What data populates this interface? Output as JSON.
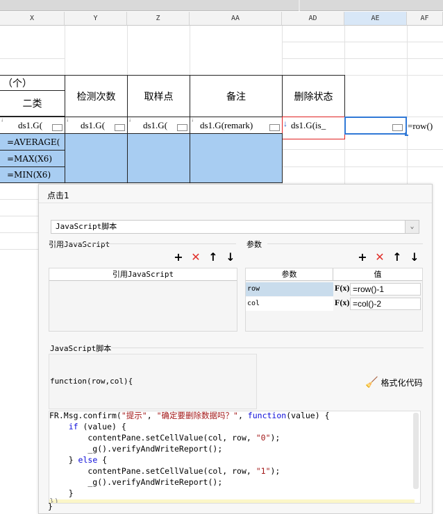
{
  "columns": [
    {
      "id": "x",
      "label": "X"
    },
    {
      "id": "y",
      "label": "Y"
    },
    {
      "id": "z",
      "label": "Z"
    },
    {
      "id": "aa",
      "label": "AA"
    },
    {
      "id": "ad",
      "label": "AD"
    },
    {
      "id": "ae",
      "label": "AE",
      "selected": true
    },
    {
      "id": "af",
      "label": "AF"
    }
  ],
  "grid": {
    "unit_label": "（个）",
    "category_label": "二类",
    "headers": {
      "inspect_count": "检测次数",
      "sample_point": "取样点",
      "remark": "备注",
      "delete_status": "删除状态"
    },
    "ds_cells": {
      "x": "ds1.G(",
      "y": "ds1.G(",
      "z": "ds1.G(",
      "aa": "ds1.G(remark)",
      "ad": "ds1.G(is_",
      "af": "=row()"
    },
    "formulas": {
      "avg": "=AVERAGE(",
      "max": "=MAX(X6)",
      "min": "=MIN(X6)"
    }
  },
  "dialog": {
    "title": "点击1",
    "script_type": "JavaScript脚本",
    "ref_js_label": "引用JavaScript",
    "ref_js_header": "引用JavaScript",
    "params_label": "参数",
    "params_table": {
      "col_param": "参数",
      "col_value": "值",
      "rows": [
        {
          "name": "row",
          "fx": "F(x)",
          "value": "=row()-1"
        },
        {
          "name": "col",
          "fx": "F(x)",
          "value": "=col()-2"
        }
      ]
    },
    "script_label": "JavaScript脚本",
    "function_sig": "function(row,col){",
    "format_button": "格式化代码",
    "code_lines": [
      "FR.Msg.confirm(\"提示\", \"确定要删除数据吗？\", function(value) {",
      "    if (value) {",
      "        contentPane.setCellValue(col, row, \"0\");",
      "        _g().verifyAndWriteReport();",
      "    } else {",
      "        contentPane.setCellValue(col, row, \"1\");",
      "        _g().verifyAndWriteReport();",
      "    }",
      "})"
    ],
    "closing_brace": "}"
  },
  "colors": {
    "selection_fill": "#a8cdf2",
    "selected_border": "#2f78d6",
    "error_border": "#e02020",
    "delete_icon": "#e0302b"
  }
}
